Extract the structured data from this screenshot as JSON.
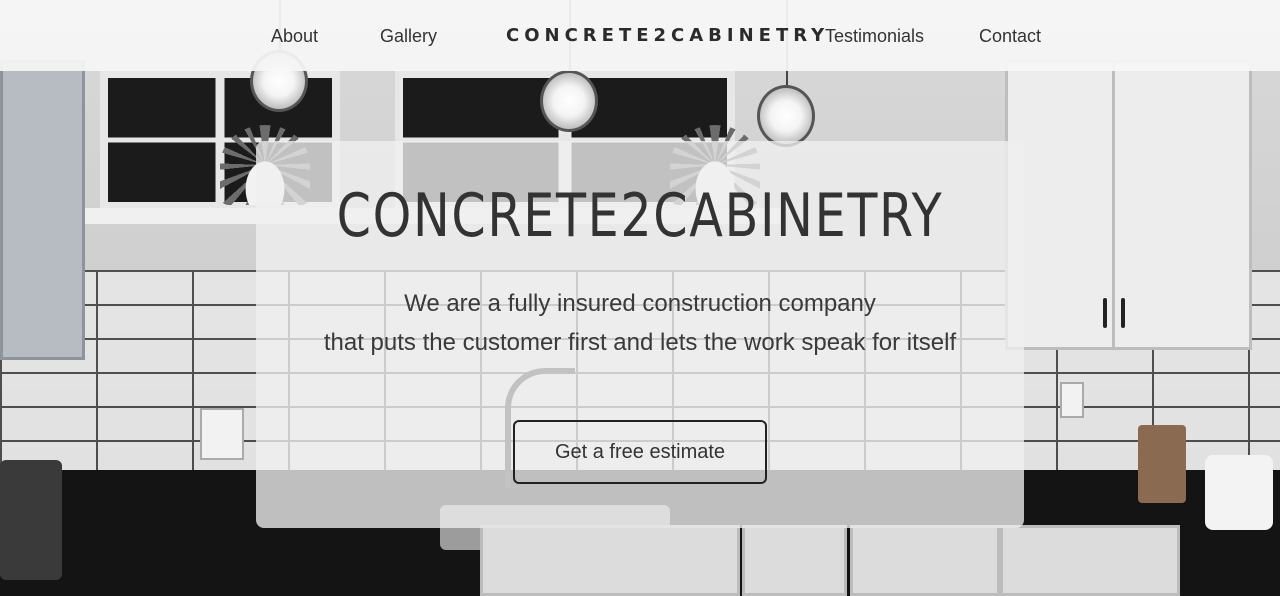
{
  "nav": {
    "about": "About",
    "gallery": "Gallery",
    "brand": "CONCRETE2CABINETRY",
    "testimonials": "Testimonials",
    "contact": "Contact"
  },
  "hero": {
    "title": "CONCRETE2CABINETRY",
    "line1": "We are a fully insured construction company",
    "line2": "that puts the customer first and lets the work speak for itself",
    "cta_label": "Get a free estimate"
  },
  "colors": {
    "nav_background": "#f6f6f6",
    "text": "#333333",
    "button_border": "#222222",
    "card_background": "#f0f0f0"
  }
}
